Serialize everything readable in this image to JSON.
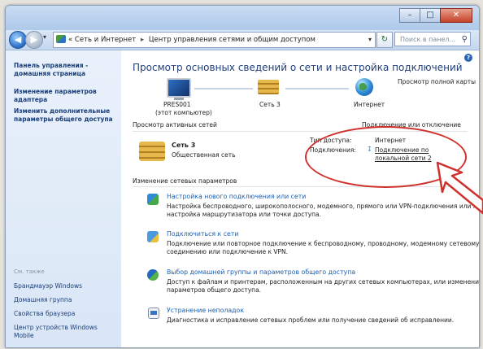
{
  "window": {
    "buttons": {
      "minimize": "–",
      "maximize": "□",
      "close": "✕"
    }
  },
  "nav": {
    "back_glyph": "◀",
    "forward_glyph": "▶",
    "dropdown_glyph": "▾",
    "breadcrumb_prefix": "«",
    "breadcrumb": [
      "Сеть и Интернет",
      "Центр управления сетями и общим доступом"
    ],
    "separator": "▸",
    "refresh_glyph": "↻",
    "search_placeholder": "Поиск в панел..."
  },
  "sidebar": {
    "home_link": "Панель управления - домашняя страница",
    "links": [
      "Изменение параметров адаптера",
      "Изменить дополнительные параметры общего доступа"
    ],
    "see_also_label": "См. также",
    "see_also": [
      "Брандмауэр Windows",
      "Домашняя группа",
      "Свойства браузера",
      "Центр устройств Windows Mobile"
    ]
  },
  "main": {
    "help_glyph": "?",
    "title": "Просмотр основных сведений о сети и настройка подключений",
    "full_map_link": "Просмотр полной карты",
    "map": {
      "computer_name": "PRES001",
      "computer_sub": "(этот компьютер)",
      "network_name": "Сеть 3",
      "internet": "Интернет"
    },
    "active_networks_label": "Просмотр активных сетей",
    "connect_disconnect_link": "Подключение или отключение",
    "network": {
      "name": "Сеть 3",
      "type_link": "Общественная сеть",
      "access_type_label": "Тип доступа:",
      "access_type_value": "Интернет",
      "connections_label": "Подключения:",
      "connection_link_line1": "Подключение по",
      "connection_link_line2": "локальной сети 2"
    },
    "change_settings_label": "Изменение сетевых параметров",
    "tasks": [
      {
        "title": "Настройка нового подключения или сети",
        "desc": "Настройка беспроводного, широкополосного, модемного, прямого или VPN-подключения или же настройка маршрутизатора или точки доступа."
      },
      {
        "title": "Подключиться к сети",
        "desc": "Подключение или повторное подключение к беспроводному, проводному, модемному сетевому соединению или подключение к VPN."
      },
      {
        "title": "Выбор домашней группы и параметров общего доступа",
        "desc": "Доступ к файлам и принтерам, расположенным на других сетевых компьютерах, или изменение параметров общего доступа."
      },
      {
        "title": "Устранение неполадок",
        "desc": "Диагностика и исправление сетевых проблем или получение сведений об исправлении."
      }
    ]
  },
  "colors": {
    "link": "#1c5fb4",
    "callout": "#d0312d"
  }
}
